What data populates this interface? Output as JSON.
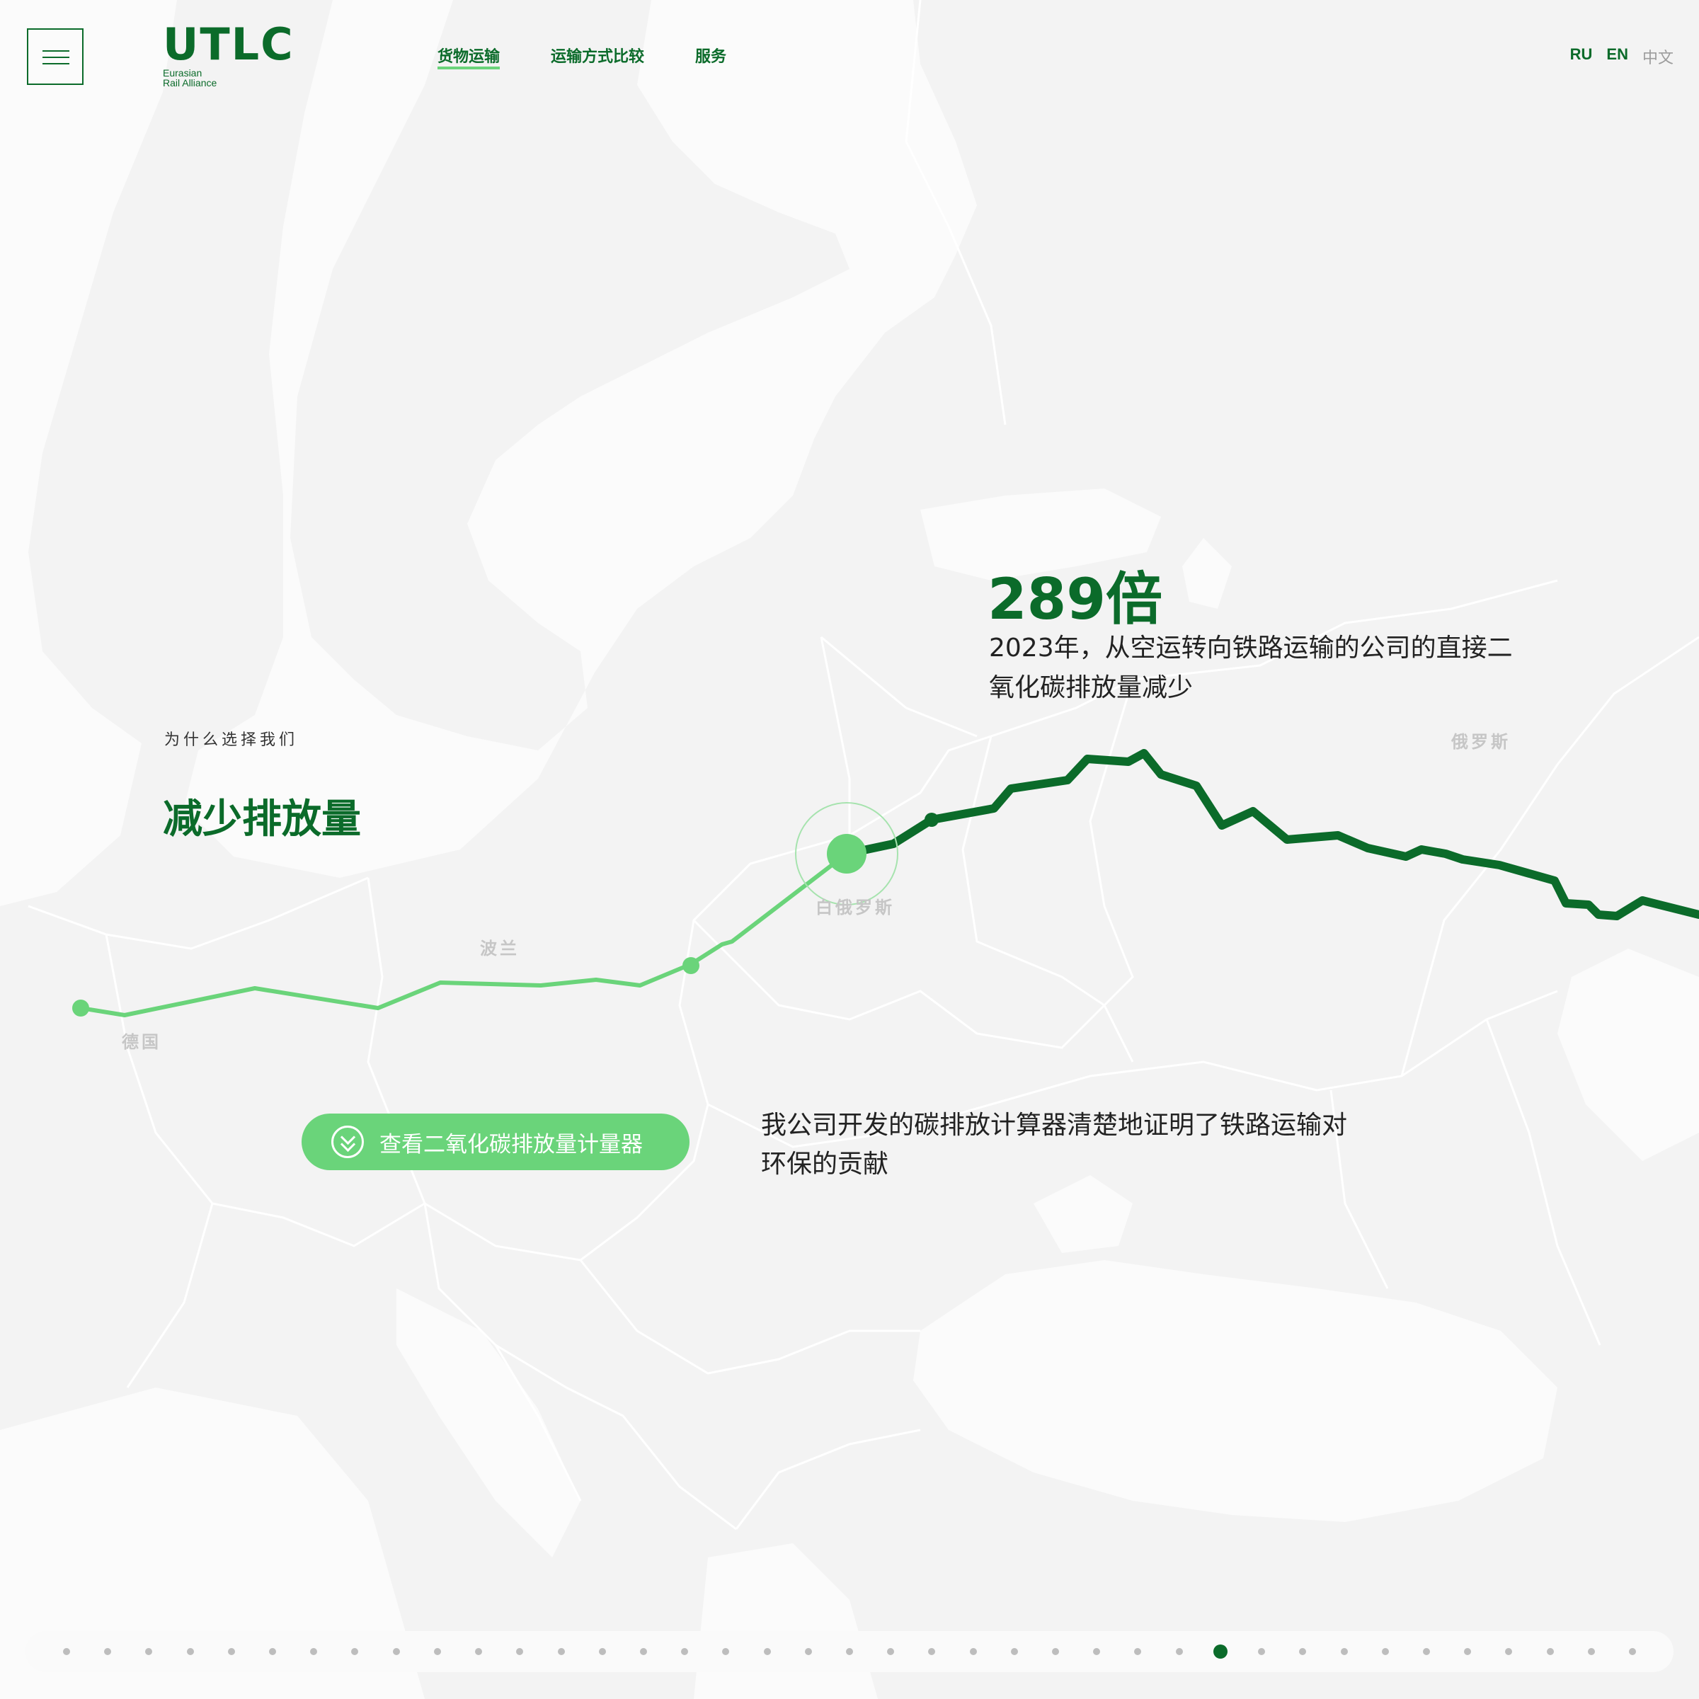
{
  "header": {
    "logo_text": "UTLC",
    "logo_sub_line1": "Eurasian",
    "logo_sub_line2": "Rail Alliance",
    "nav": [
      {
        "label": "货物运输",
        "active": true
      },
      {
        "label": "运输方式比较",
        "active": false
      },
      {
        "label": "服务",
        "active": false
      }
    ],
    "languages": [
      {
        "label": "RU",
        "current": false
      },
      {
        "label": "EN",
        "current": false
      },
      {
        "label": "中文",
        "current": true
      }
    ]
  },
  "section": {
    "kicker": "为什么选择我们",
    "title": "减少排放量"
  },
  "stat": {
    "value": "289倍",
    "description": "2023年，从空运转向铁路运输的公司的直接二氧化碳排放量减少"
  },
  "calculator": {
    "button_label": "查看二氧化碳排放量计量器",
    "description": "我公司开发的碳排放计算器清楚地证明了铁路运输对环保的贡献"
  },
  "map": {
    "countries": [
      "德国",
      "波兰",
      "白俄罗斯",
      "俄罗斯"
    ],
    "colors": {
      "route_light": "#6ad47a",
      "route_dark": "#0b6b2a",
      "land": "#f3f3f3",
      "sea": "#fbfbfb"
    }
  },
  "pager": {
    "total": 39,
    "active_index": 28
  },
  "icons": {
    "menu": "hamburger-icon",
    "button": "double-chevron-down-icon"
  }
}
